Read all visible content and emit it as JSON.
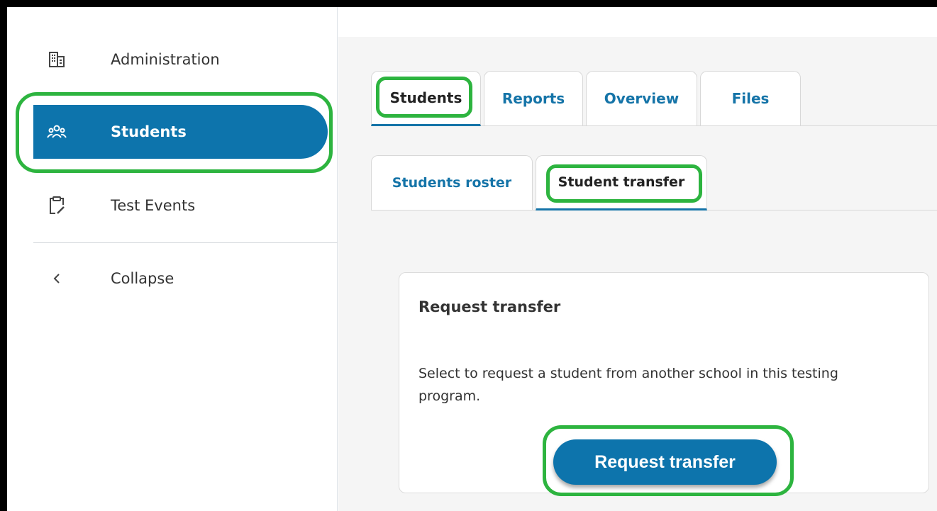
{
  "sidebar": {
    "items": [
      {
        "label": "Administration",
        "icon": "building-icon"
      },
      {
        "label": "Students",
        "icon": "users-icon",
        "active": true
      },
      {
        "label": "Test Events",
        "icon": "clipboard-edit-icon"
      },
      {
        "label": "Collapse",
        "icon": "chevron-left-icon"
      }
    ]
  },
  "tabs": [
    {
      "label": "Students",
      "active": true
    },
    {
      "label": "Reports"
    },
    {
      "label": "Overview"
    },
    {
      "label": "Files"
    }
  ],
  "subtabs": [
    {
      "label": "Students roster"
    },
    {
      "label": "Student transfer",
      "active": true
    }
  ],
  "card": {
    "title": "Request transfer",
    "description": "Select to request a student from another school in this testing program.",
    "button_label": "Request transfer"
  },
  "colors": {
    "accent": "#0d74ac",
    "highlight": "#2db43f",
    "background": "#f5f5f5"
  }
}
